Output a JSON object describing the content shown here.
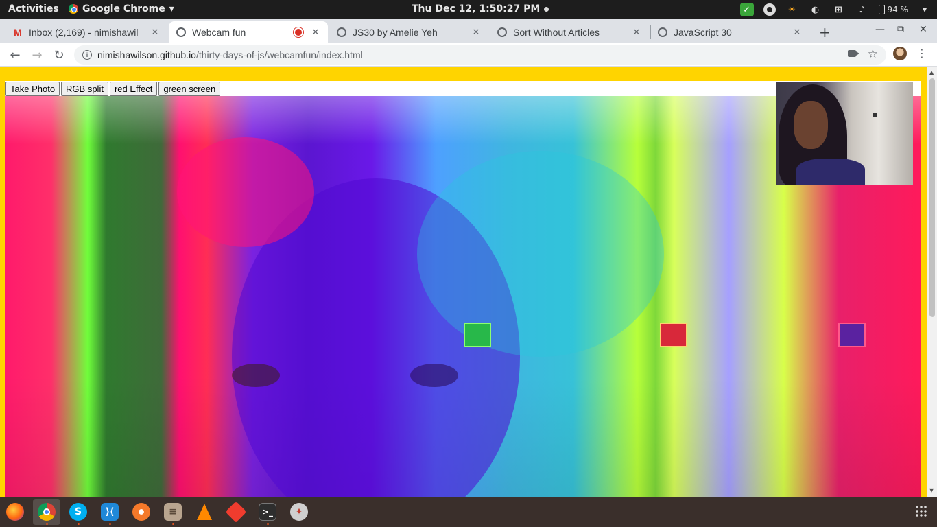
{
  "topbar": {
    "activities": "Activities",
    "app_name": "Google Chrome",
    "app_menu_arrow": "▾",
    "clock": "Thu Dec 12,  1:50:27 PM",
    "battery": "94 %"
  },
  "tabs": [
    {
      "label": "Inbox (2,169) - nimishawil",
      "favicon": "gmail-icon",
      "close": "✕"
    },
    {
      "label": "Webcam fun",
      "favicon": "globe-icon",
      "close": "✕",
      "recording": true
    },
    {
      "label": "JS30 by Amelie Yeh",
      "favicon": "globe-icon",
      "close": "✕"
    },
    {
      "label": "Sort Without Articles",
      "favicon": "globe-icon",
      "close": "✕"
    },
    {
      "label": "JavaScript 30",
      "favicon": "globe-icon",
      "close": "✕"
    }
  ],
  "tabstrip": {
    "new_tab": "+",
    "minimize": "—",
    "maximize": "⧉",
    "close": "✕"
  },
  "toolbar": {
    "back": "←",
    "forward": "→",
    "reload": "↻",
    "url_host": "nimishawilson.github.io",
    "url_path": "/thirty-days-of-js/webcamfun/index.html",
    "star": "☆",
    "menu": "⋮"
  },
  "page": {
    "buttons": [
      "Take Photo",
      "RGB split",
      "red Effect",
      "green screen"
    ]
  },
  "colors": {
    "page_background": "#ffd400",
    "topbar": "#1d1d1d",
    "dock": "#3a2f2b",
    "accent": "#e95420"
  },
  "dock": [
    {
      "name": "firefox-icon"
    },
    {
      "name": "chrome-icon",
      "active": true
    },
    {
      "name": "skype-icon"
    },
    {
      "name": "vscode-icon"
    },
    {
      "name": "blender-icon"
    },
    {
      "name": "files-icon"
    },
    {
      "name": "vlc-icon"
    },
    {
      "name": "git-icon"
    },
    {
      "name": "terminal-icon"
    },
    {
      "name": "settings-icon"
    }
  ]
}
